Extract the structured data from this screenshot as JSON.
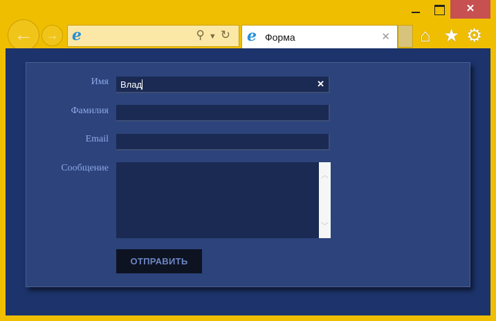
{
  "browser": {
    "tab_title": "Форма",
    "icons": [
      "back-arrow-icon",
      "forward-arrow-icon",
      "ie-logo-icon",
      "search-icon",
      "dropdown-icon",
      "refresh-icon",
      "close-icon",
      "home-icon",
      "star-icon",
      "gear-icon"
    ],
    "accent_color": "#f0be00",
    "close_color": "#c75050"
  },
  "form": {
    "fields": [
      {
        "label": "Имя",
        "value": "Влад"
      },
      {
        "label": "Фамилия",
        "value": ""
      },
      {
        "label": "Email",
        "value": ""
      }
    ],
    "message_label": "Сообщение",
    "message_value": "",
    "submit_label": "ОТПРАВИТЬ"
  }
}
